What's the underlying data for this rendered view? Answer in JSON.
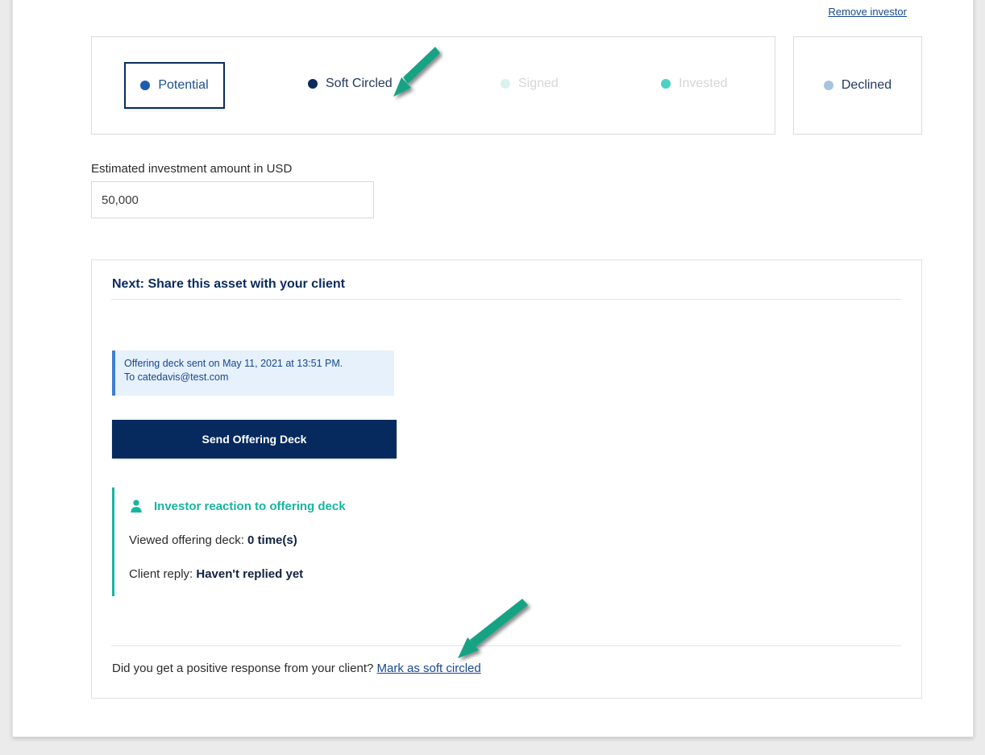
{
  "header": {
    "remove_investor_label": "Remove investor"
  },
  "status_bar": {
    "items": [
      {
        "label": "Potential",
        "dot_color": "#1b5cad",
        "state": "selected"
      },
      {
        "label": "Soft Circled",
        "dot_color": "#0a2b5c",
        "state": "active"
      },
      {
        "label": "Signed",
        "dot_color": "#d9f1ef",
        "state": "disabled"
      },
      {
        "label": "Invested",
        "dot_color": "#4ed1c5",
        "state": "disabled"
      }
    ],
    "declined": {
      "label": "Declined",
      "dot_color": "#a9c3e0",
      "state": "inactive"
    }
  },
  "amount": {
    "label": "Estimated investment amount in USD",
    "value": "50,000",
    "placeholder": "Estimated investment amount in USD"
  },
  "next_panel": {
    "title": "Next: Share this asset with your client",
    "sent_notice_line1": "Offering deck sent on May 11, 2021 at 13:51 PM.",
    "sent_notice_line2": "To catedavis@test.com",
    "send_button_label": "Send Offering Deck",
    "reaction": {
      "heading": "Investor reaction to offering deck",
      "viewed_label": "Viewed offering deck:",
      "viewed_value": "0 time(s)",
      "reply_label": "Client reply:",
      "reply_value": "Haven't replied yet"
    },
    "cta_question": "Did you get a positive response from your client?",
    "cta_link": "Mark as soft circled"
  },
  "annotations": {
    "arrow_color": "#12a383",
    "arrow_1_target": "Soft Circled",
    "arrow_2_target": "Mark as soft circled"
  }
}
